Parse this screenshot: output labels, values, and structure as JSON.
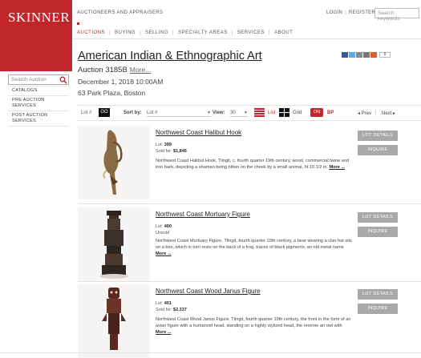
{
  "brand": {
    "logo_text": "SKINNER",
    "tagline": "AUCTIONEERS AND APPRAISERS",
    "color": "#c0262c"
  },
  "top_links": {
    "login": "LOGIN",
    "register": "REGISTER",
    "search_placeholder": "Search keywords"
  },
  "nav": [
    {
      "label": "AUCTIONS",
      "active": true
    },
    {
      "label": "BUYING"
    },
    {
      "label": "SELLING"
    },
    {
      "label": "SPECIALTY AREAS"
    },
    {
      "label": "SERVICES"
    },
    {
      "label": "ABOUT"
    }
  ],
  "sidebar": {
    "search_placeholder": "Search Auction",
    "items": [
      {
        "label": "CATALOGS"
      },
      {
        "label": "PRE AUCTION SERVICES"
      },
      {
        "label": "POST AUCTION SERVICES"
      }
    ]
  },
  "auction": {
    "title": "American Indian & Ethnographic Art",
    "number": "Auction 3185B",
    "more": "More...",
    "date": "December 1, 2018 10:00AM",
    "address": "63 Park Plaza, Boston"
  },
  "share": {
    "count": "0"
  },
  "toolbar": {
    "lot_label": "Lot #",
    "go": "GO",
    "sort_by": "Sort by:",
    "sort_value": "Lot #",
    "view": "View:",
    "view_value": "30",
    "list": "List",
    "grid": "Grid",
    "bp_toggle": "ON",
    "bp": "BP",
    "prev": "◂ Prev",
    "next": "Next ▸"
  },
  "lots": [
    {
      "title": "Northwest Coast Halibut Hook",
      "lot_label": "Lot:",
      "lot_number": "399",
      "status_label": "Sold for:",
      "status_value": "$1,845",
      "description": "Northwest Coast Halibut Hook, Tlingit, c. fourth quarter 19th century, wood, commercial twine and iron barb, depicting a shaman being bitten on the cheek by a small animal, ht 10 1/2 in.",
      "more": "More ...",
      "details_label": "LOT DETAILS",
      "inquire_label": "INQUIRE"
    },
    {
      "title": "Northwest Coast Mortuary Figure",
      "lot_label": "Lot:",
      "lot_number": "400",
      "status_label": "Unsold",
      "status_value": "",
      "description": "Northwest Coast Mortuary Figure, Tlingit, fourth quarter 19th century, a bear wearing a clan hat sits on a box, which in turn rests on the back of a frog, traces of black pigments, an old metal name",
      "more": "More ...",
      "details_label": "LOT DETAILS",
      "inquire_label": "INQUIRE"
    },
    {
      "title": "Northwest Coast Wood Janus Figure",
      "lot_label": "Lot:",
      "lot_number": "401",
      "status_label": "Sold for:",
      "status_value": "$2,337",
      "description": "Northwest Coast Wood Janus Figure, Tlingit, fourth quarter 19th century, the front in the form of an avian figure with a humanoid head, standing on a highly stylized head, the reverse an owl with",
      "more": "More ...",
      "details_label": "LOT DETAILS",
      "inquire_label": "INQUIRE"
    }
  ]
}
